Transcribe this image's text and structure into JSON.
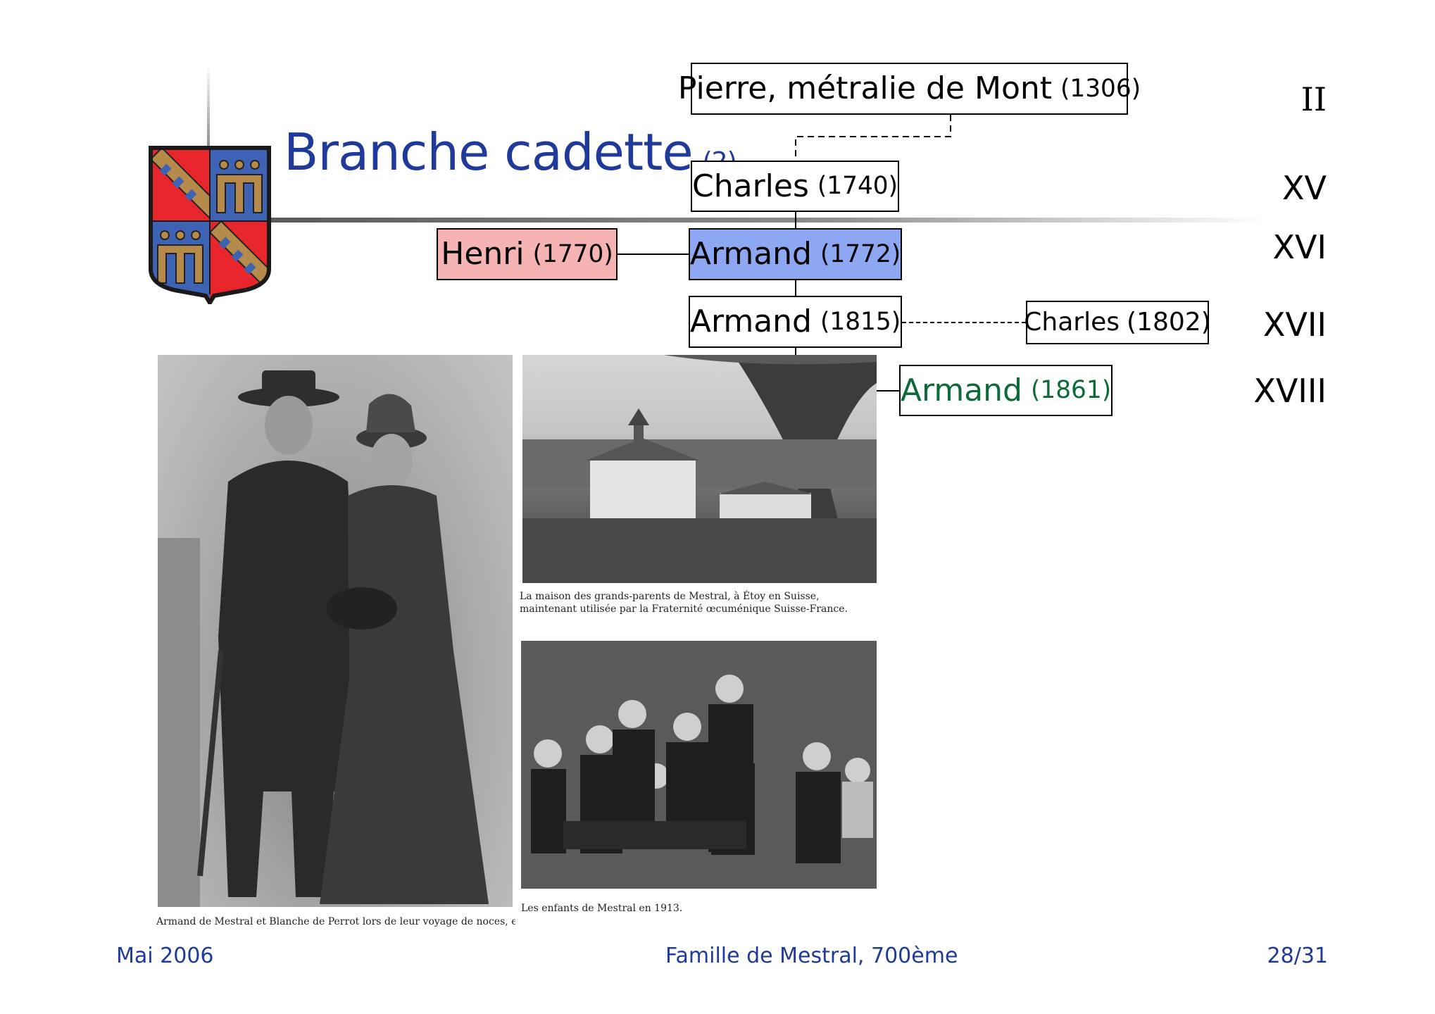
{
  "slide": {
    "title": "Branche cadette",
    "title_sub": "(2)"
  },
  "tree": {
    "pierre": {
      "name": "Pierre, métralie de Mont",
      "year": "(1306)"
    },
    "charles_1740": {
      "name": "Charles",
      "year": "(1740)"
    },
    "henri": {
      "name": "Henri",
      "year": "(1770)"
    },
    "armand_1772": {
      "name": "Armand",
      "year": "(1772)"
    },
    "armand_1815": {
      "name": "Armand",
      "year": "(1815)"
    },
    "charles_1802": {
      "name": "Charles",
      "year": "(1802)"
    },
    "armand_1861": {
      "name": "Armand",
      "year": "(1861)"
    }
  },
  "generations": [
    "II",
    "XV",
    "XVI",
    "XVII",
    "XVIII"
  ],
  "captions": {
    "house": "La maison des grands-parents de Mestral, à Étoy en Suisse, maintenant utilisée par la Fraternité œcuménique Suisse-France.",
    "kids": "Les enfants de Mestral en 1913.",
    "couple": "Armand de Mestral et Blanche de Perrot lors de leur voyage de noces, en"
  },
  "footer": {
    "date": "Mai 2006",
    "center": "Famille de Mestral, 700ème",
    "page": "28/31"
  },
  "colors": {
    "title_blue": "#1f3a9b",
    "henri_box": "#f6b3b3",
    "armand_1772_box": "#8ea7f3",
    "armand_1861_text": "#0f6a3a",
    "shield_red": "#e8252a",
    "shield_blue": "#3e63b5",
    "shield_gold": "#b58a4a"
  }
}
